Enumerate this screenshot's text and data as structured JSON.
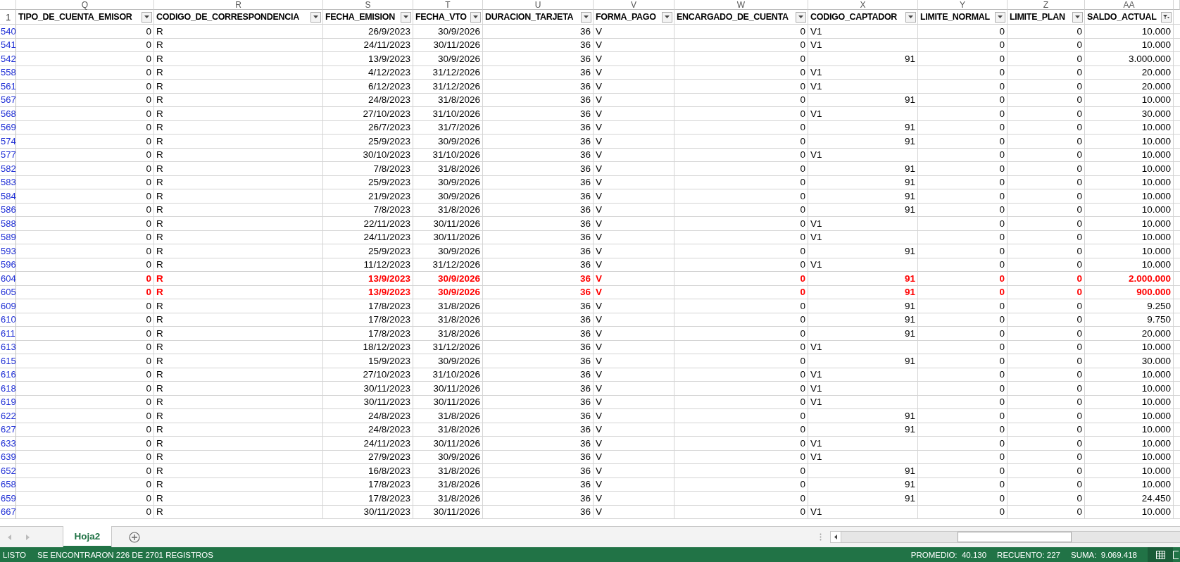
{
  "column_letters": [
    "Q",
    "R",
    "S",
    "T",
    "U",
    "V",
    "W",
    "X",
    "Y",
    "Z",
    "AA"
  ],
  "header_row": "1",
  "columns": [
    {
      "label": "TIPO_DE_CUENTA_EMISOR",
      "kind": "number",
      "filtered": false
    },
    {
      "label": "CODIGO_DE_CORRESPONDENCIA",
      "kind": "text",
      "filtered": false
    },
    {
      "label": "FECHA_EMISION",
      "kind": "number",
      "filtered": false
    },
    {
      "label": "FECHA_VTO",
      "kind": "number",
      "filtered": false
    },
    {
      "label": "DURACION_TARJETA",
      "kind": "number",
      "filtered": false
    },
    {
      "label": "FORMA_PAGO",
      "kind": "text",
      "filtered": false
    },
    {
      "label": "ENCARGADO_DE_CUENTA",
      "kind": "number",
      "filtered": false
    },
    {
      "label": "CODIGO_CAPTADOR",
      "kind": "mixed",
      "filtered": false
    },
    {
      "label": "LIMITE_NORMAL",
      "kind": "number",
      "filtered": false
    },
    {
      "label": "LIMITE_PLAN",
      "kind": "number",
      "filtered": false
    },
    {
      "label": "SALDO_ACTUAL",
      "kind": "number",
      "filtered": true
    }
  ],
  "rows": [
    {
      "row": "540",
      "highlighted": false,
      "kind": "text",
      "cells": [
        "0",
        "R",
        "26/9/2023",
        "30/9/2026",
        "36",
        "V",
        "0",
        "V1",
        "0",
        "0",
        "10.000"
      ]
    },
    {
      "row": "541",
      "highlighted": false,
      "kind": "text",
      "cells": [
        "0",
        "R",
        "24/11/2023",
        "30/11/2026",
        "36",
        "V",
        "0",
        "V1",
        "0",
        "0",
        "10.000"
      ]
    },
    {
      "row": "542",
      "highlighted": false,
      "kind": "number",
      "cells": [
        "0",
        "R",
        "13/9/2023",
        "30/9/2026",
        "36",
        "V",
        "0",
        "91",
        "0",
        "0",
        "3.000.000"
      ]
    },
    {
      "row": "558",
      "highlighted": false,
      "kind": "text",
      "cells": [
        "0",
        "R",
        "4/12/2023",
        "31/12/2026",
        "36",
        "V",
        "0",
        "V1",
        "0",
        "0",
        "20.000"
      ]
    },
    {
      "row": "561",
      "highlighted": false,
      "kind": "text",
      "cells": [
        "0",
        "R",
        "6/12/2023",
        "31/12/2026",
        "36",
        "V",
        "0",
        "V1",
        "0",
        "0",
        "20.000"
      ]
    },
    {
      "row": "567",
      "highlighted": false,
      "kind": "number",
      "cells": [
        "0",
        "R",
        "24/8/2023",
        "31/8/2026",
        "36",
        "V",
        "0",
        "91",
        "0",
        "0",
        "10.000"
      ]
    },
    {
      "row": "568",
      "highlighted": false,
      "kind": "text",
      "cells": [
        "0",
        "R",
        "27/10/2023",
        "31/10/2026",
        "36",
        "V",
        "0",
        "V1",
        "0",
        "0",
        "30.000"
      ]
    },
    {
      "row": "569",
      "highlighted": false,
      "kind": "number",
      "cells": [
        "0",
        "R",
        "26/7/2023",
        "31/7/2026",
        "36",
        "V",
        "0",
        "91",
        "0",
        "0",
        "10.000"
      ]
    },
    {
      "row": "574",
      "highlighted": false,
      "kind": "number",
      "cells": [
        "0",
        "R",
        "25/9/2023",
        "30/9/2026",
        "36",
        "V",
        "0",
        "91",
        "0",
        "0",
        "10.000"
      ]
    },
    {
      "row": "577",
      "highlighted": false,
      "kind": "text",
      "cells": [
        "0",
        "R",
        "30/10/2023",
        "31/10/2026",
        "36",
        "V",
        "0",
        "V1",
        "0",
        "0",
        "10.000"
      ]
    },
    {
      "row": "582",
      "highlighted": false,
      "kind": "number",
      "cells": [
        "0",
        "R",
        "7/8/2023",
        "31/8/2026",
        "36",
        "V",
        "0",
        "91",
        "0",
        "0",
        "10.000"
      ]
    },
    {
      "row": "583",
      "highlighted": false,
      "kind": "number",
      "cells": [
        "0",
        "R",
        "25/9/2023",
        "30/9/2026",
        "36",
        "V",
        "0",
        "91",
        "0",
        "0",
        "10.000"
      ]
    },
    {
      "row": "584",
      "highlighted": false,
      "kind": "number",
      "cells": [
        "0",
        "R",
        "21/9/2023",
        "30/9/2026",
        "36",
        "V",
        "0",
        "91",
        "0",
        "0",
        "10.000"
      ]
    },
    {
      "row": "586",
      "highlighted": false,
      "kind": "number",
      "cells": [
        "0",
        "R",
        "7/8/2023",
        "31/8/2026",
        "36",
        "V",
        "0",
        "91",
        "0",
        "0",
        "10.000"
      ]
    },
    {
      "row": "588",
      "highlighted": false,
      "kind": "text",
      "cells": [
        "0",
        "R",
        "22/11/2023",
        "30/11/2026",
        "36",
        "V",
        "0",
        "V1",
        "0",
        "0",
        "10.000"
      ]
    },
    {
      "row": "589",
      "highlighted": false,
      "kind": "text",
      "cells": [
        "0",
        "R",
        "24/11/2023",
        "30/11/2026",
        "36",
        "V",
        "0",
        "V1",
        "0",
        "0",
        "10.000"
      ]
    },
    {
      "row": "593",
      "highlighted": false,
      "kind": "number",
      "cells": [
        "0",
        "R",
        "25/9/2023",
        "30/9/2026",
        "36",
        "V",
        "0",
        "91",
        "0",
        "0",
        "10.000"
      ]
    },
    {
      "row": "596",
      "highlighted": false,
      "kind": "text",
      "cells": [
        "0",
        "R",
        "11/12/2023",
        "31/12/2026",
        "36",
        "V",
        "0",
        "V1",
        "0",
        "0",
        "10.000"
      ]
    },
    {
      "row": "604",
      "highlighted": true,
      "kind": "number",
      "cells": [
        "0",
        "R",
        "13/9/2023",
        "30/9/2026",
        "36",
        "V",
        "0",
        "91",
        "0",
        "0",
        "2.000.000"
      ]
    },
    {
      "row": "605",
      "highlighted": true,
      "kind": "number",
      "cells": [
        "0",
        "R",
        "13/9/2023",
        "30/9/2026",
        "36",
        "V",
        "0",
        "91",
        "0",
        "0",
        "900.000"
      ]
    },
    {
      "row": "609",
      "highlighted": false,
      "kind": "number",
      "cells": [
        "0",
        "R",
        "17/8/2023",
        "31/8/2026",
        "36",
        "V",
        "0",
        "91",
        "0",
        "0",
        "9.250"
      ]
    },
    {
      "row": "610",
      "highlighted": false,
      "kind": "number",
      "cells": [
        "0",
        "R",
        "17/8/2023",
        "31/8/2026",
        "36",
        "V",
        "0",
        "91",
        "0",
        "0",
        "9.750"
      ]
    },
    {
      "row": "611",
      "highlighted": false,
      "kind": "number",
      "cells": [
        "0",
        "R",
        "17/8/2023",
        "31/8/2026",
        "36",
        "V",
        "0",
        "91",
        "0",
        "0",
        "20.000"
      ]
    },
    {
      "row": "613",
      "highlighted": false,
      "kind": "text",
      "cells": [
        "0",
        "R",
        "18/12/2023",
        "31/12/2026",
        "36",
        "V",
        "0",
        "V1",
        "0",
        "0",
        "10.000"
      ]
    },
    {
      "row": "615",
      "highlighted": false,
      "kind": "number",
      "cells": [
        "0",
        "R",
        "15/9/2023",
        "30/9/2026",
        "36",
        "V",
        "0",
        "91",
        "0",
        "0",
        "30.000"
      ]
    },
    {
      "row": "616",
      "highlighted": false,
      "kind": "text",
      "cells": [
        "0",
        "R",
        "27/10/2023",
        "31/10/2026",
        "36",
        "V",
        "0",
        "V1",
        "0",
        "0",
        "10.000"
      ]
    },
    {
      "row": "618",
      "highlighted": false,
      "kind": "text",
      "cells": [
        "0",
        "R",
        "30/11/2023",
        "30/11/2026",
        "36",
        "V",
        "0",
        "V1",
        "0",
        "0",
        "10.000"
      ]
    },
    {
      "row": "619",
      "highlighted": false,
      "kind": "text",
      "cells": [
        "0",
        "R",
        "30/11/2023",
        "30/11/2026",
        "36",
        "V",
        "0",
        "V1",
        "0",
        "0",
        "10.000"
      ]
    },
    {
      "row": "622",
      "highlighted": false,
      "kind": "number",
      "cells": [
        "0",
        "R",
        "24/8/2023",
        "31/8/2026",
        "36",
        "V",
        "0",
        "91",
        "0",
        "0",
        "10.000"
      ]
    },
    {
      "row": "627",
      "highlighted": false,
      "kind": "number",
      "cells": [
        "0",
        "R",
        "24/8/2023",
        "31/8/2026",
        "36",
        "V",
        "0",
        "91",
        "0",
        "0",
        "10.000"
      ]
    },
    {
      "row": "633",
      "highlighted": false,
      "kind": "text",
      "cells": [
        "0",
        "R",
        "24/11/2023",
        "30/11/2026",
        "36",
        "V",
        "0",
        "V1",
        "0",
        "0",
        "10.000"
      ]
    },
    {
      "row": "639",
      "highlighted": false,
      "kind": "text",
      "cells": [
        "0",
        "R",
        "27/9/2023",
        "30/9/2026",
        "36",
        "V",
        "0",
        "V1",
        "0",
        "0",
        "10.000"
      ]
    },
    {
      "row": "652",
      "highlighted": false,
      "kind": "number",
      "cells": [
        "0",
        "R",
        "16/8/2023",
        "31/8/2026",
        "36",
        "V",
        "0",
        "91",
        "0",
        "0",
        "10.000"
      ]
    },
    {
      "row": "658",
      "highlighted": false,
      "kind": "number",
      "cells": [
        "0",
        "R",
        "17/8/2023",
        "31/8/2026",
        "36",
        "V",
        "0",
        "91",
        "0",
        "0",
        "10.000"
      ]
    },
    {
      "row": "659",
      "highlighted": false,
      "kind": "number",
      "cells": [
        "0",
        "R",
        "17/8/2023",
        "31/8/2026",
        "36",
        "V",
        "0",
        "91",
        "0",
        "0",
        "24.450"
      ]
    },
    {
      "row": "667",
      "highlighted": false,
      "kind": "text",
      "cells": [
        "0",
        "R",
        "30/11/2023",
        "30/11/2026",
        "36",
        "V",
        "0",
        "V1",
        "0",
        "0",
        "10.000"
      ]
    }
  ],
  "sheet_tabs": [
    {
      "label": "Hoja2",
      "selected": true
    }
  ],
  "status_bar": {
    "mode": "LISTO",
    "message": "SE ENCONTRARON 226 DE 2701 REGISTROS",
    "stats": [
      "PROMEDIO:  40.130",
      "RECUENTO: 227",
      "SUMA:  9.069.418"
    ]
  }
}
